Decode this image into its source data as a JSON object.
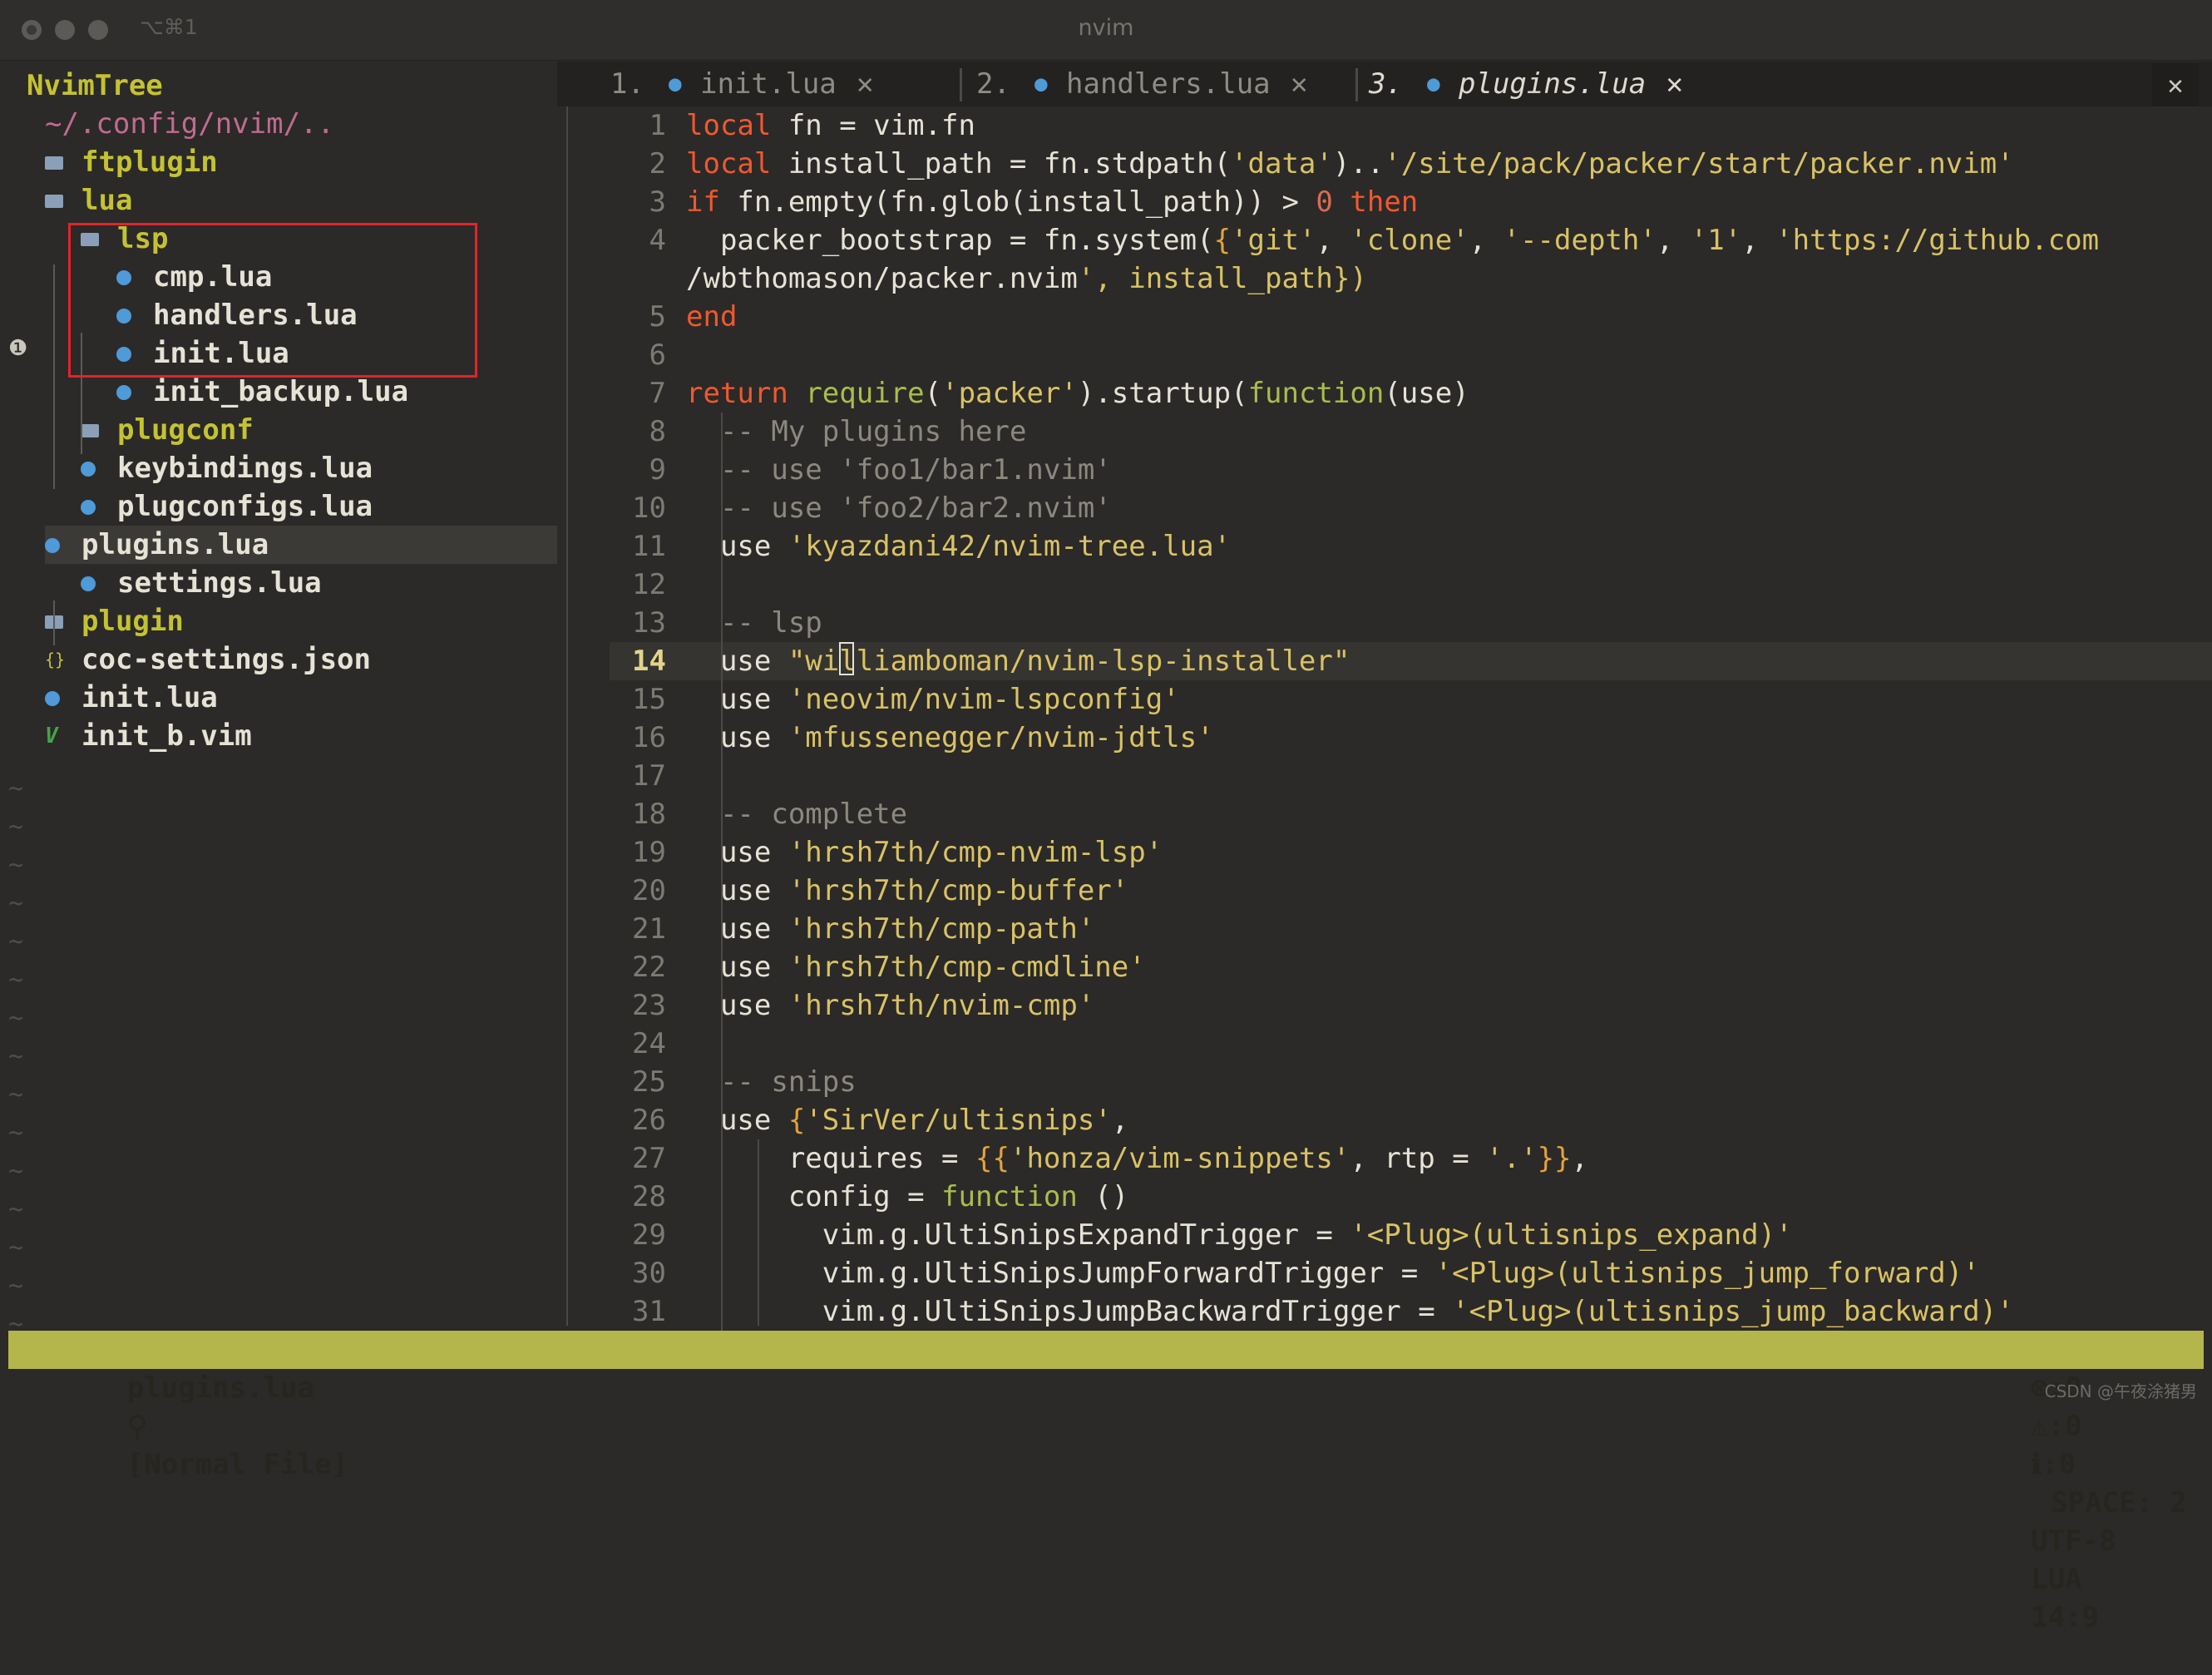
{
  "window": {
    "title": "nvim",
    "shortcut": "⌥⌘1"
  },
  "tree": {
    "title": "NvimTree",
    "root": "~/.config/nvim/..",
    "items": [
      {
        "name": "ftplugin",
        "icon": "folder-icon",
        "type": "folder"
      },
      {
        "name": "lua",
        "icon": "folder-open-icon",
        "type": "folder"
      },
      {
        "name": "lsp",
        "icon": "folder-open-icon",
        "type": "folder"
      },
      {
        "name": "cmp.lua",
        "icon": "lua-icon",
        "type": "file"
      },
      {
        "name": "handlers.lua",
        "icon": "lua-icon",
        "type": "file"
      },
      {
        "name": "init.lua",
        "icon": "lua-icon",
        "type": "file"
      },
      {
        "name": "init_backup.lua",
        "icon": "lua-icon",
        "type": "file"
      },
      {
        "name": "plugconf",
        "icon": "folder-icon",
        "type": "folder"
      },
      {
        "name": "keybindings.lua",
        "icon": "lua-icon",
        "type": "file"
      },
      {
        "name": "plugconfigs.lua",
        "icon": "lua-icon",
        "type": "file"
      },
      {
        "name": "plugins.lua",
        "icon": "lua-icon",
        "type": "file"
      },
      {
        "name": "settings.lua",
        "icon": "lua-icon",
        "type": "file"
      },
      {
        "name": "plugin",
        "icon": "folder-icon",
        "type": "folder"
      },
      {
        "name": "coc-settings.json",
        "icon": "json-icon",
        "type": "file"
      },
      {
        "name": "init.lua",
        "icon": "lua-icon",
        "type": "file"
      },
      {
        "name": "init_b.vim",
        "icon": "vim-icon",
        "type": "file"
      }
    ],
    "empty_marker": "~"
  },
  "tabs": [
    {
      "index": "1.",
      "name": "init.lua",
      "close": "✕"
    },
    {
      "index": "2.",
      "name": "handlers.lua",
      "close": "✕"
    },
    {
      "index": "3.",
      "name": "plugins.lua",
      "close": "✕",
      "active": true
    }
  ],
  "close_all": "✕",
  "editor": {
    "current_line": 14,
    "lines": [
      {
        "n": "1",
        "t": "local fn = vim.fn"
      },
      {
        "n": "2",
        "t": "local install_path = fn.stdpath('data')..'/site/pack/packer/start/packer.nvim'"
      },
      {
        "n": "3",
        "t": "if fn.empty(fn.glob(install_path)) > 0 then"
      },
      {
        "n": "4",
        "t": "  packer_bootstrap = fn.system({'git', 'clone', '--depth', '1', 'https://github.com"
      },
      {
        "n": "",
        "t": "/wbthomason/packer.nvim', install_path})"
      },
      {
        "n": "5",
        "t": "end"
      },
      {
        "n": "6",
        "t": ""
      },
      {
        "n": "7",
        "t": "return require('packer').startup(function(use)"
      },
      {
        "n": "8",
        "t": "  -- My plugins here"
      },
      {
        "n": "9",
        "t": "  -- use 'foo1/bar1.nvim'"
      },
      {
        "n": "10",
        "t": "  -- use 'foo2/bar2.nvim'"
      },
      {
        "n": "11",
        "t": "  use 'kyazdani42/nvim-tree.lua'"
      },
      {
        "n": "12",
        "t": ""
      },
      {
        "n": "13",
        "t": "  -- lsp"
      },
      {
        "n": "14",
        "t": "  use \"williamboman/nvim-lsp-installer\""
      },
      {
        "n": "15",
        "t": "  use 'neovim/nvim-lspconfig'"
      },
      {
        "n": "16",
        "t": "  use 'mfussenegger/nvim-jdtls'"
      },
      {
        "n": "17",
        "t": ""
      },
      {
        "n": "18",
        "t": "  -- complete"
      },
      {
        "n": "19",
        "t": "  use 'hrsh7th/cmp-nvim-lsp'"
      },
      {
        "n": "20",
        "t": "  use 'hrsh7th/cmp-buffer'"
      },
      {
        "n": "21",
        "t": "  use 'hrsh7th/cmp-path'"
      },
      {
        "n": "22",
        "t": "  use 'hrsh7th/cmp-cmdline'"
      },
      {
        "n": "23",
        "t": "  use 'hrsh7th/nvim-cmp'"
      },
      {
        "n": "24",
        "t": ""
      },
      {
        "n": "25",
        "t": "  -- snips"
      },
      {
        "n": "26",
        "t": "  use {'SirVer/ultisnips',"
      },
      {
        "n": "27",
        "t": "      requires = {{'honza/vim-snippets', rtp = '.'}},"
      },
      {
        "n": "28",
        "t": "      config = function ()"
      },
      {
        "n": "29",
        "t": "        vim.g.UltiSnipsExpandTrigger = '<Plug>(ultisnips_expand)'"
      },
      {
        "n": "30",
        "t": "        vim.g.UltiSnipsJumpForwardTrigger = '<Plug>(ultisnips_jump_forward)'"
      },
      {
        "n": "31",
        "t": "        vim.g.UltiSnipsJumpBackwardTrigger = '<Plug>(ultisnips_jump_backward)'"
      }
    ]
  },
  "statusline": {
    "filename": "plugins.lua",
    "mode": "[Normal File]",
    "errors": "⊗:0",
    "warnings": "⚠:0",
    "info": "ℹ:0",
    "indent": "SPACE: 2",
    "encoding": "UTF-8",
    "filetype": "LUA",
    "position": "14:9"
  },
  "watermark": "CSDN @午夜涂猪男",
  "colors": {
    "keyword": "#f1582f",
    "string": "#d9c265",
    "comment": "#8c887f",
    "function": "#a9bd4d",
    "folder": "#c4c233",
    "status_bg": "#b4b54a",
    "highlight_box": "#e5222a"
  }
}
